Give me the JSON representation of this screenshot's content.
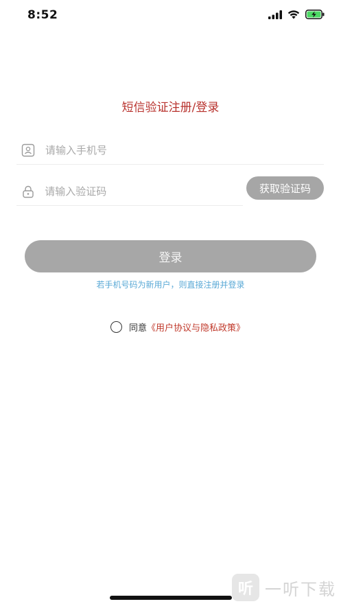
{
  "status": {
    "time": "8:52"
  },
  "title": "短信验证注册/登录",
  "phone": {
    "placeholder": "请输入手机号",
    "value": ""
  },
  "code": {
    "placeholder": "请输入验证码",
    "value": "",
    "button_label": "获取验证码"
  },
  "login_label": "登录",
  "hint": "若手机号码为新用户，则直接注册并登录",
  "agreement": {
    "prefix": "同意",
    "link": "《用户协议与隐私政策》"
  },
  "watermark": {
    "logo_char": "听",
    "text": "一听下载"
  },
  "colors": {
    "title": "#b8322d",
    "link": "#c0392b",
    "hint": "#5aa9d6",
    "button": "#a7a7a7"
  }
}
